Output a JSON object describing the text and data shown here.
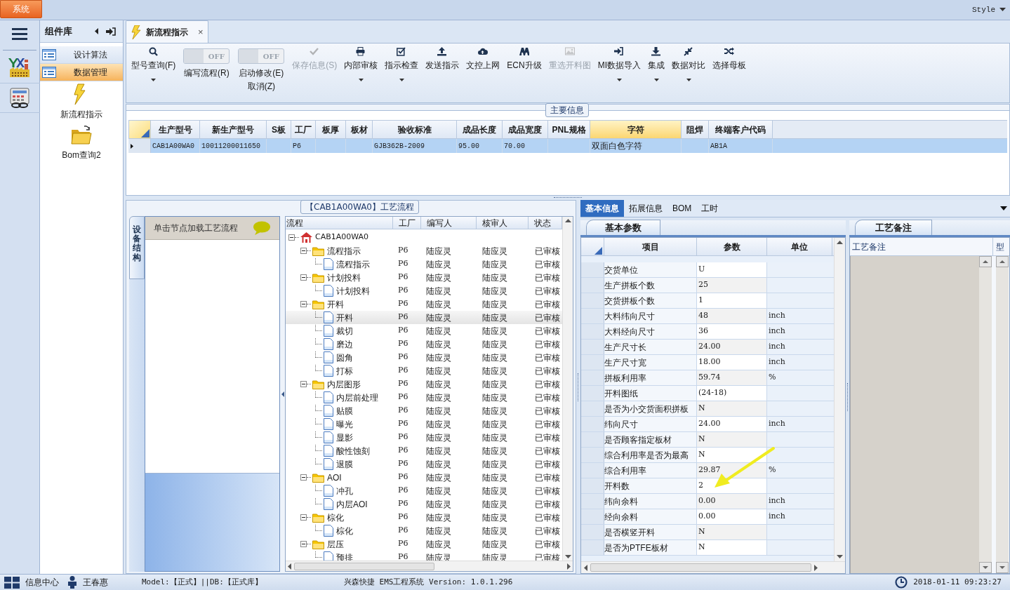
{
  "system_button": "系统",
  "style_menu": "Style",
  "component_panel": {
    "title": "组件库",
    "categories": [
      {
        "label": "设计算法",
        "selected": false
      },
      {
        "label": "数据管理",
        "selected": true
      }
    ],
    "launchers": [
      {
        "label": "新流程指示"
      },
      {
        "label": "Bom查询2"
      }
    ]
  },
  "document_tab": {
    "title": "新流程指示",
    "close": "×"
  },
  "toolbar": [
    {
      "kind": "button",
      "label": "型号查询(F)",
      "dropdown": true,
      "disabled": false
    },
    {
      "kind": "toggle",
      "label": "编写流程(R)",
      "switch_text": "OFF",
      "on": false
    },
    {
      "kind": "toggle",
      "label": "启动修改(E)",
      "label_2": "取消(Z)",
      "switch_text": "OFF",
      "on": false
    },
    {
      "kind": "button",
      "label": "保存信息(S)",
      "dropdown": false,
      "disabled": true
    },
    {
      "kind": "button",
      "label": "内部审核",
      "dropdown": true,
      "disabled": false
    },
    {
      "kind": "button",
      "label": "指示检查",
      "dropdown": true,
      "disabled": false
    },
    {
      "kind": "button",
      "label": "发送指示",
      "dropdown": false,
      "disabled": false
    },
    {
      "kind": "button",
      "label": "文控上网",
      "dropdown": false,
      "disabled": false
    },
    {
      "kind": "button",
      "label": "ECN升级",
      "dropdown": false,
      "disabled": false
    },
    {
      "kind": "button",
      "label": "重选开料图",
      "dropdown": false,
      "disabled": true
    },
    {
      "kind": "button",
      "label": "MI数据导入",
      "dropdown": true,
      "disabled": false
    },
    {
      "kind": "button",
      "label": "集成",
      "dropdown": true,
      "disabled": false
    },
    {
      "kind": "button",
      "label": "数据对比",
      "dropdown": true,
      "disabled": false
    },
    {
      "kind": "button",
      "label": "选择母板",
      "dropdown": false,
      "disabled": false
    }
  ],
  "main_info": {
    "title": "主要信息",
    "columns": [
      {
        "label": "生产型号",
        "selected": false
      },
      {
        "label": "新生产型号",
        "selected": false
      },
      {
        "label": "S板",
        "selected": false
      },
      {
        "label": "工厂",
        "selected": false
      },
      {
        "label": "板厚",
        "selected": false
      },
      {
        "label": "板材",
        "selected": false
      },
      {
        "label": "验收标准",
        "selected": false
      },
      {
        "label": "成品长度",
        "selected": false
      },
      {
        "label": "成品宽度",
        "selected": false
      },
      {
        "label": "PNL规格",
        "selected": false
      },
      {
        "label": "字符",
        "selected": true
      },
      {
        "label": "阻焊",
        "selected": false
      },
      {
        "label": "终端客户代码",
        "selected": false
      }
    ],
    "rows": [
      {
        "selected": true,
        "cells": [
          "CAB1A00WA0",
          "10011200011650",
          null,
          "P6",
          null,
          null,
          "GJB362B-2009",
          "95.00",
          "70.00",
          null,
          "双面白色字符",
          null,
          "AB1A"
        ]
      }
    ]
  },
  "process": {
    "title": "【CAB1A00WA0】工艺流程",
    "side_tab": "设备结构",
    "hint": "单击节点加载工艺流程",
    "columns": [
      "流程",
      "工厂",
      "编写人",
      "核审人",
      "状态"
    ],
    "tree": {
      "label": "CAB1A00WA0",
      "expanded": true,
      "selected": false,
      "children": [
        {
          "label": "流程指示",
          "factory": "P6",
          "writer": "陆应灵",
          "reviewer": "陆应灵",
          "status": "已审核",
          "expanded": true,
          "selected": false,
          "children": [
            {
              "label": "流程指示",
              "factory": "P6",
              "writer": "陆应灵",
              "reviewer": "陆应灵",
              "status": "已审核",
              "selected": false
            }
          ]
        },
        {
          "label": "计划投料",
          "factory": "P6",
          "writer": "陆应灵",
          "reviewer": "陆应灵",
          "status": "已审核",
          "expanded": true,
          "selected": false,
          "children": [
            {
              "label": "计划投料",
              "factory": "P6",
              "writer": "陆应灵",
              "reviewer": "陆应灵",
              "status": "已审核",
              "selected": false
            }
          ]
        },
        {
          "label": "开料",
          "factory": "P6",
          "writer": "陆应灵",
          "reviewer": "陆应灵",
          "status": "已审核",
          "expanded": true,
          "selected": false,
          "children": [
            {
              "label": "开料",
              "factory": "P6",
              "writer": "陆应灵",
              "reviewer": "陆应灵",
              "status": "已审核",
              "selected": true
            },
            {
              "label": "裁切",
              "factory": "P6",
              "writer": "陆应灵",
              "reviewer": "陆应灵",
              "status": "已审核",
              "selected": false
            },
            {
              "label": "磨边",
              "factory": "P6",
              "writer": "陆应灵",
              "reviewer": "陆应灵",
              "status": "已审核",
              "selected": false
            },
            {
              "label": "圆角",
              "factory": "P6",
              "writer": "陆应灵",
              "reviewer": "陆应灵",
              "status": "已审核",
              "selected": false
            },
            {
              "label": "打标",
              "factory": "P6",
              "writer": "陆应灵",
              "reviewer": "陆应灵",
              "status": "已审核",
              "selected": false
            }
          ]
        },
        {
          "label": "内层图形",
          "factory": "P6",
          "writer": "陆应灵",
          "reviewer": "陆应灵",
          "status": "已审核",
          "expanded": true,
          "selected": false,
          "children": [
            {
              "label": "内层前处理",
              "factory": "P6",
              "writer": "陆应灵",
              "reviewer": "陆应灵",
              "status": "已审核",
              "selected": false
            },
            {
              "label": "贴膜",
              "factory": "P6",
              "writer": "陆应灵",
              "reviewer": "陆应灵",
              "status": "已审核",
              "selected": false
            },
            {
              "label": "曝光",
              "factory": "P6",
              "writer": "陆应灵",
              "reviewer": "陆应灵",
              "status": "已审核",
              "selected": false
            },
            {
              "label": "显影",
              "factory": "P6",
              "writer": "陆应灵",
              "reviewer": "陆应灵",
              "status": "已审核",
              "selected": false
            },
            {
              "label": "酸性蚀刻",
              "factory": "P6",
              "writer": "陆应灵",
              "reviewer": "陆应灵",
              "status": "已审核",
              "selected": false
            },
            {
              "label": "退膜",
              "factory": "P6",
              "writer": "陆应灵",
              "reviewer": "陆应灵",
              "status": "已审核",
              "selected": false
            }
          ]
        },
        {
          "label": "AOI",
          "factory": "P6",
          "writer": "陆应灵",
          "reviewer": "陆应灵",
          "status": "已审核",
          "expanded": true,
          "selected": false,
          "children": [
            {
              "label": "冲孔",
              "factory": "P6",
              "writer": "陆应灵",
              "reviewer": "陆应灵",
              "status": "已审核",
              "selected": false
            },
            {
              "label": "内层AOI",
              "factory": "P6",
              "writer": "陆应灵",
              "reviewer": "陆应灵",
              "status": "已审核",
              "selected": false
            }
          ]
        },
        {
          "label": "棕化",
          "factory": "P6",
          "writer": "陆应灵",
          "reviewer": "陆应灵",
          "status": "已审核",
          "expanded": true,
          "selected": false,
          "children": [
            {
              "label": "棕化",
              "factory": "P6",
              "writer": "陆应灵",
              "reviewer": "陆应灵",
              "status": "已审核",
              "selected": false
            }
          ]
        },
        {
          "label": "层压",
          "factory": "P6",
          "writer": "陆应灵",
          "reviewer": "陆应灵",
          "status": "已审核",
          "expanded": true,
          "selected": false,
          "children": [
            {
              "label": "预排",
              "factory": "P6",
              "writer": "陆应灵",
              "reviewer": "陆应灵",
              "status": "已审核",
              "selected": false
            }
          ]
        }
      ]
    }
  },
  "detail_tabs": [
    {
      "label": "基本信息",
      "selected": true
    },
    {
      "label": "拓展信息",
      "selected": false
    },
    {
      "label": "BOM",
      "selected": false
    },
    {
      "label": "工时",
      "selected": false
    }
  ],
  "params": {
    "tab": "基本参数",
    "columns": [
      "项目",
      "参数",
      "单位"
    ],
    "rows": [
      {
        "item": "交货单位",
        "value": "U"
      },
      {
        "item": "生产拼板个数",
        "value": "25"
      },
      {
        "item": "交货拼板个数",
        "value": "1"
      },
      {
        "item": "大料纬向尺寸",
        "value": "48",
        "unit": "inch"
      },
      {
        "item": "大料经向尺寸",
        "value": "36",
        "unit": "inch"
      },
      {
        "item": "生产尺寸长",
        "value": "24.00",
        "unit": "inch"
      },
      {
        "item": "生产尺寸宽",
        "value": "18.00",
        "unit": "inch"
      },
      {
        "item": "拼板利用率",
        "value": "59.74",
        "unit": "%"
      },
      {
        "item": "开料图纸",
        "value": "(24-18)"
      },
      {
        "item": "是否为小交货面积拼板",
        "value": "N"
      },
      {
        "item": "纬向尺寸",
        "value": "24.00",
        "unit": "inch"
      },
      {
        "item": "是否顾客指定板材",
        "value": "N"
      },
      {
        "item": "综合利用率是否为最高",
        "value": "N"
      },
      {
        "item": "综合利用率",
        "value": "29.87",
        "unit": "%"
      },
      {
        "item": "开料数",
        "value": "2"
      },
      {
        "item": "纬向余料",
        "value": "0.00",
        "unit": "inch"
      },
      {
        "item": "经向余料",
        "value": "0.00",
        "unit": "inch"
      },
      {
        "item": "是否横竖开料",
        "value": "N"
      },
      {
        "item": "是否为PTFE板材",
        "value": "N"
      }
    ]
  },
  "notes": {
    "tab": "工艺备注",
    "columns": [
      "工艺备注",
      "型"
    ]
  },
  "status_bar": {
    "info_center": "信息中心",
    "user": "王春惠",
    "model": "Model:【正式】||DB:【正式库】",
    "app": "兴森快捷 EMS工程系统 Version: 1.0.1.296",
    "datetime": "2018-01-11 09:23:27"
  }
}
